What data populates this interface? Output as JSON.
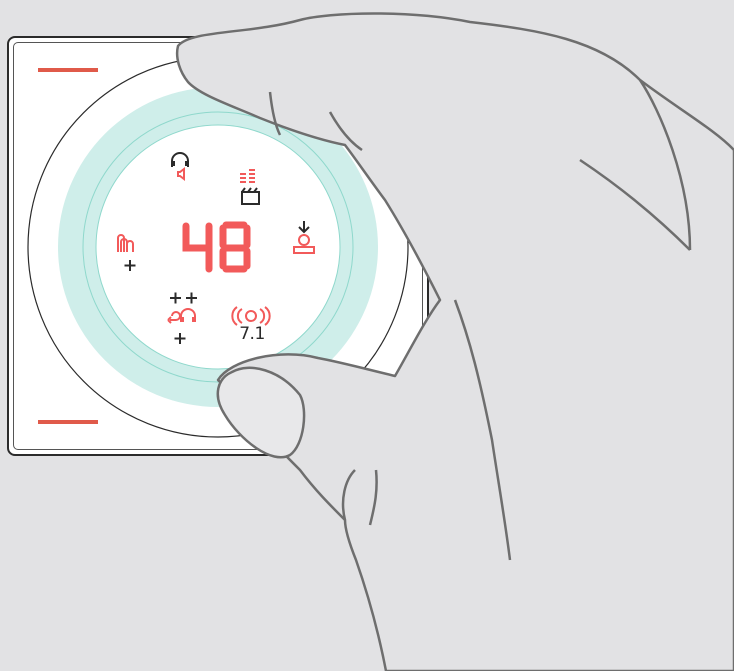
{
  "display": {
    "value": "48",
    "digit_color": "#f25a5a"
  },
  "icons": [
    {
      "name": "headset-speaker-icon"
    },
    {
      "name": "equalizer-video-icon"
    },
    {
      "name": "download-user-icon"
    },
    {
      "name": "ambient-boost-icon"
    },
    {
      "name": "sidetone-headset-boost-icon"
    },
    {
      "name": "surround-7-1-icon",
      "label": "7.1"
    }
  ],
  "colors": {
    "accent": "#e05a4a",
    "ring": "#cfeeea",
    "background": "#e2e2e4"
  }
}
